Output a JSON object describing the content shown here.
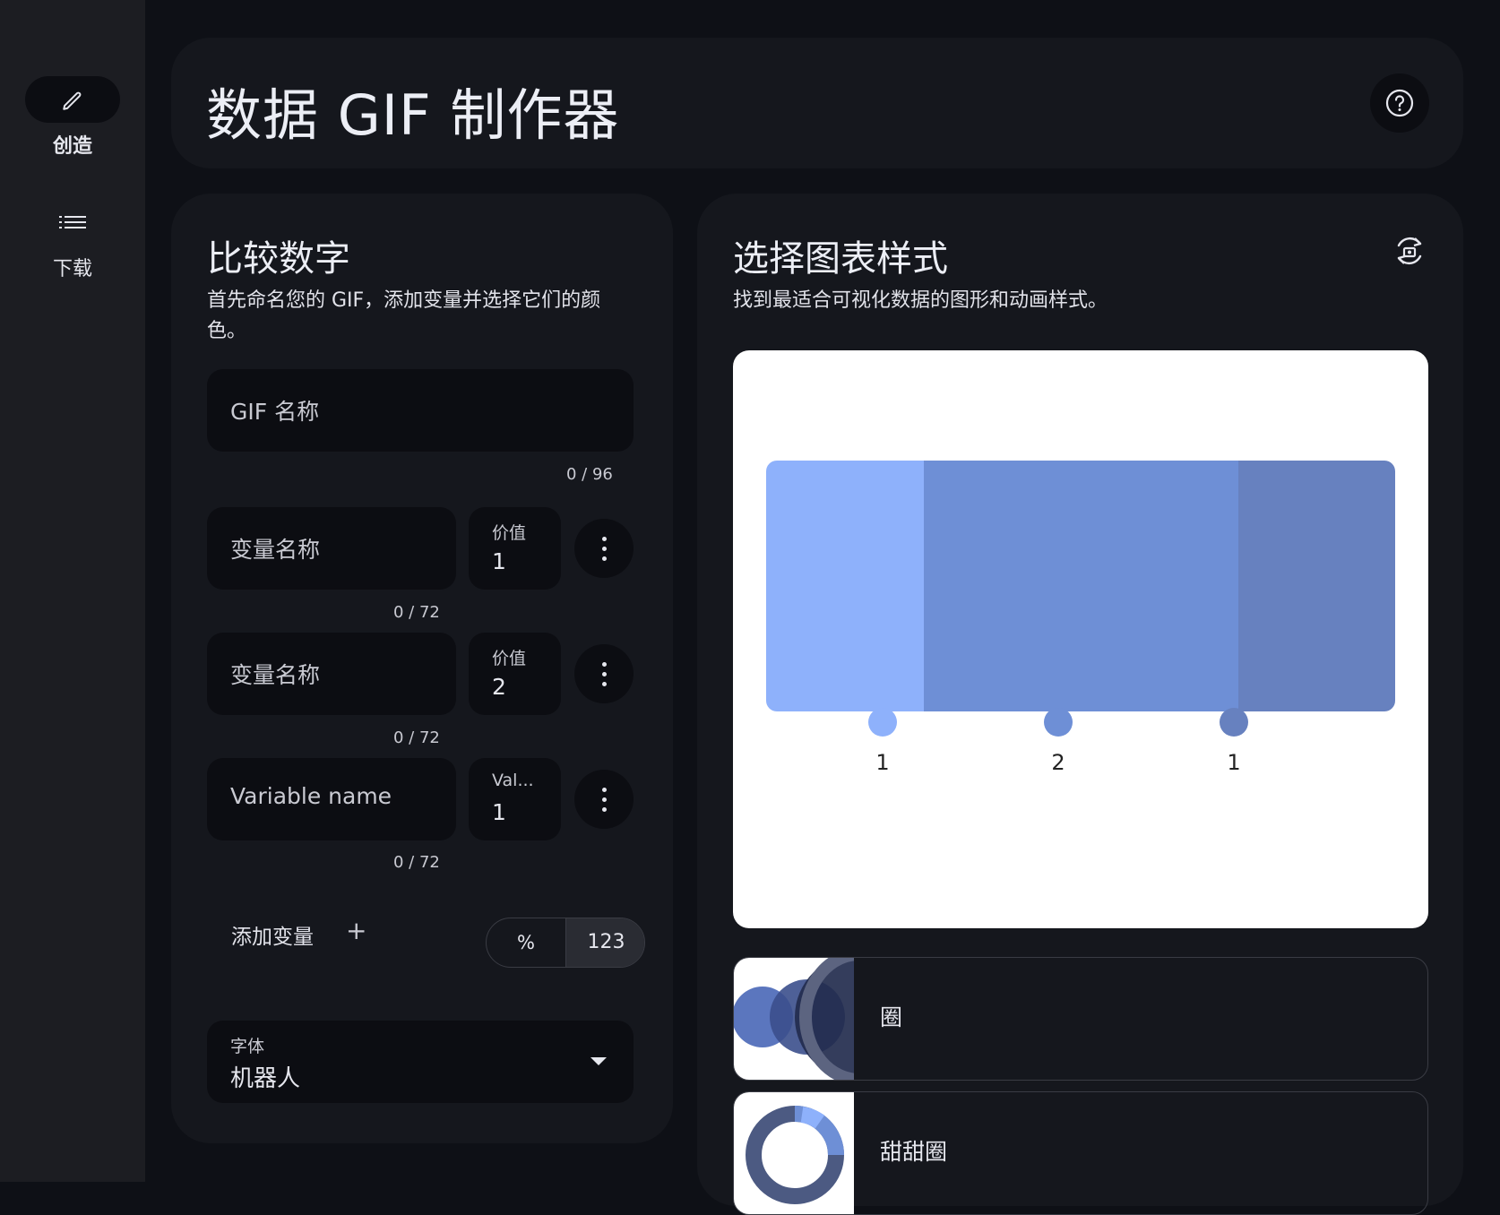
{
  "nav": {
    "items": [
      {
        "label": "创造",
        "icon": "pencil-icon",
        "active": true
      },
      {
        "label": "下载",
        "icon": "list-icon",
        "active": false
      }
    ]
  },
  "header": {
    "title": "数据 GIF 制作器",
    "help_icon": "help-circle-icon"
  },
  "compare": {
    "title": "比较数字",
    "description": "首先命名您的 GIF，添加变量并选择它们的颜色。",
    "gif_name": {
      "placeholder": "GIF 名称",
      "counter": "0 / 96"
    },
    "variables": [
      {
        "name": "变量名称",
        "value_label": "价值",
        "value": "1",
        "counter": "0 / 72"
      },
      {
        "name": "变量名称",
        "value_label": "价值",
        "value": "2",
        "counter": "0 / 72"
      },
      {
        "name": "Variable name",
        "value_label": "Val...",
        "value": "1",
        "counter": "0 / 72"
      }
    ],
    "add_variable": "添加变量",
    "add_icon": "+",
    "format_toggle": {
      "options": [
        "%",
        "123"
      ],
      "selected": "123"
    },
    "font": {
      "label": "字体",
      "value": "机器人"
    }
  },
  "chart_style": {
    "title": "选择图表样式",
    "description": "找到最适合可视化数据的图形和动画样式。",
    "refresh_icon": "replay-icon",
    "styles": [
      {
        "name": "圈"
      },
      {
        "name": "甜甜圈"
      }
    ]
  },
  "colors": {
    "series": [
      "#8eb1fb",
      "#6e8fd6",
      "#6781bf"
    ]
  },
  "chart_data": {
    "type": "bar",
    "stacked": true,
    "orientation": "horizontal",
    "categories": [
      "1",
      "2",
      "1"
    ],
    "values": [
      1,
      2,
      1
    ],
    "title": "",
    "xlabel": "",
    "ylabel": ""
  }
}
